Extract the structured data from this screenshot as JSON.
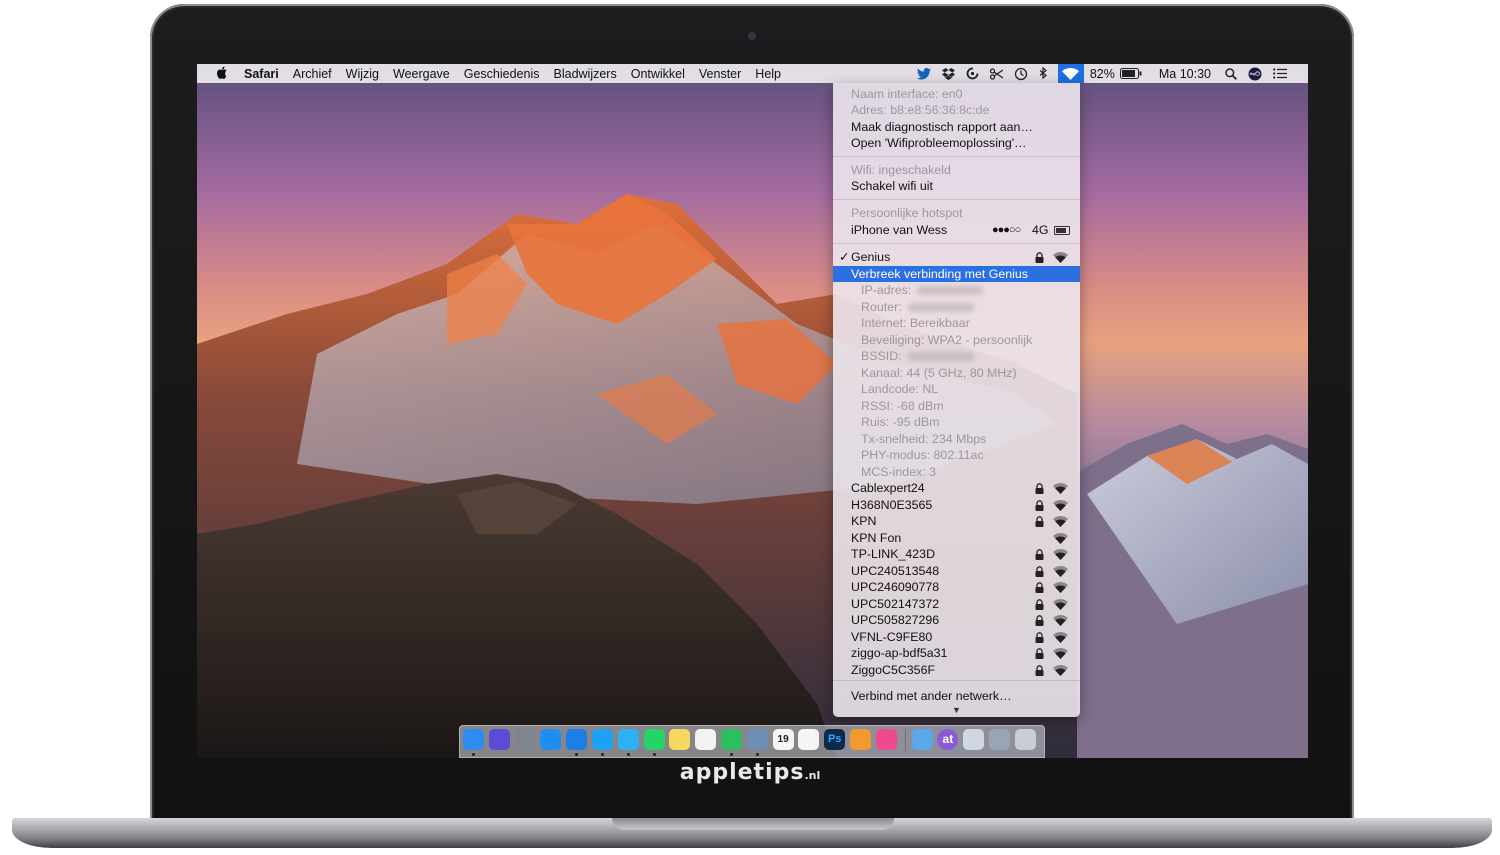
{
  "brand": {
    "name": "appletips",
    "suffix": ".nl"
  },
  "menubar": {
    "apple_icon": "apple-icon",
    "app_name": "Safari",
    "items": [
      "Archief",
      "Wijzig",
      "Weergave",
      "Geschiedenis",
      "Bladwijzers",
      "Ontwikkel",
      "Venster",
      "Help"
    ],
    "status": {
      "battery_percent": "82%",
      "clock": "Ma 10:30",
      "icons": [
        "twitter-icon",
        "dropbox-icon",
        "sync-icon",
        "scissors-icon",
        "time-machine-icon",
        "bluetooth-icon",
        "wifi-icon",
        "battery-icon",
        "spotlight-icon",
        "siri-icon",
        "notification-center-icon"
      ]
    }
  },
  "wifi_menu": {
    "interface": "Naam interface: en0",
    "address": "Adres: b8:e8:56:36:8c:de",
    "diagnostic": "Maak diagnostisch rapport aan…",
    "troubleshoot": "Open 'Wifiprobleemoplossing'…",
    "wifi_state": "Wifi: ingeschakeld",
    "wifi_toggle": "Schakel wifi uit",
    "hotspot_header": "Persoonlijke hotspot",
    "hotspot_device": "iPhone van Wess",
    "hotspot_signal": "●●●○○",
    "hotspot_network": "4G",
    "current_network": "Genius",
    "current_check": "✓",
    "disconnect": "Verbreek verbinding met Genius",
    "details": [
      "IP-adres:",
      "Router:",
      "Internet: Bereikbaar",
      "Beveiliging: WPA2 - persoonlijk",
      "BSSID:",
      "Kanaal: 44 (5 GHz, 80 MHz)",
      "Landcode: NL",
      "RSSI: -68 dBm",
      "Ruis: -95 dBm",
      "Tx-snelheid: 234 Mbps",
      "PHY-modus: 802.11ac",
      "MCS-index: 3"
    ],
    "networks": [
      "Cablexpert24",
      "H368N0E3565",
      "KPN",
      "KPN Fon",
      "TP-LINK_423D",
      "UPC240513548",
      "UPC246090778",
      "UPC502147372",
      "UPC505827296",
      "VFNL-C9FE80",
      "ziggo-ap-bdf5a31",
      "ZiggoC5C356F"
    ],
    "other_network": "Verbind met ander netwerk…",
    "more_indicator": "▼"
  },
  "dock": {
    "apps": [
      {
        "name": "finder-icon",
        "color": "#2d8cf0"
      },
      {
        "name": "siri-icon",
        "color": "#5b4bd6"
      },
      {
        "name": "launchpad-icon",
        "color": "#7d8590"
      },
      {
        "name": "app-store-icon",
        "color": "#1f8ef1"
      },
      {
        "name": "safari-icon",
        "color": "#1c7fe8"
      },
      {
        "name": "twitter-icon",
        "color": "#1da1f2"
      },
      {
        "name": "messages-icon",
        "color": "#2fb0f5"
      },
      {
        "name": "whatsapp-icon",
        "color": "#25d366"
      },
      {
        "name": "notes-icon",
        "color": "#f6d85c"
      },
      {
        "name": "reminders-icon",
        "color": "#f2f2f2"
      },
      {
        "name": "evernote-icon",
        "color": "#2dbe60"
      },
      {
        "name": "preview-icon",
        "color": "#6e8fb5"
      },
      {
        "name": "calendar-icon",
        "color": "#f5f5f5"
      },
      {
        "name": "photos-icon",
        "color": "#f5f5f5"
      },
      {
        "name": "photoshop-icon",
        "color": "#0d2a4a"
      },
      {
        "name": "pages-icon",
        "color": "#f29a2e"
      },
      {
        "name": "itunes-icon",
        "color": "#ee4b8f"
      },
      {
        "name": "downloads-folder-icon",
        "color": "#5aa8e8"
      },
      {
        "name": "at-app-icon",
        "color": "#8a5bd6"
      },
      {
        "name": "system-info-icon",
        "color": "#cfd8e2"
      },
      {
        "name": "media-folder-icon",
        "color": "#9aa5b3"
      },
      {
        "name": "trash-icon",
        "color": "#c9ced6"
      }
    ],
    "labels": {
      "photoshop": "Ps",
      "calendar": "19",
      "at": "at"
    }
  }
}
